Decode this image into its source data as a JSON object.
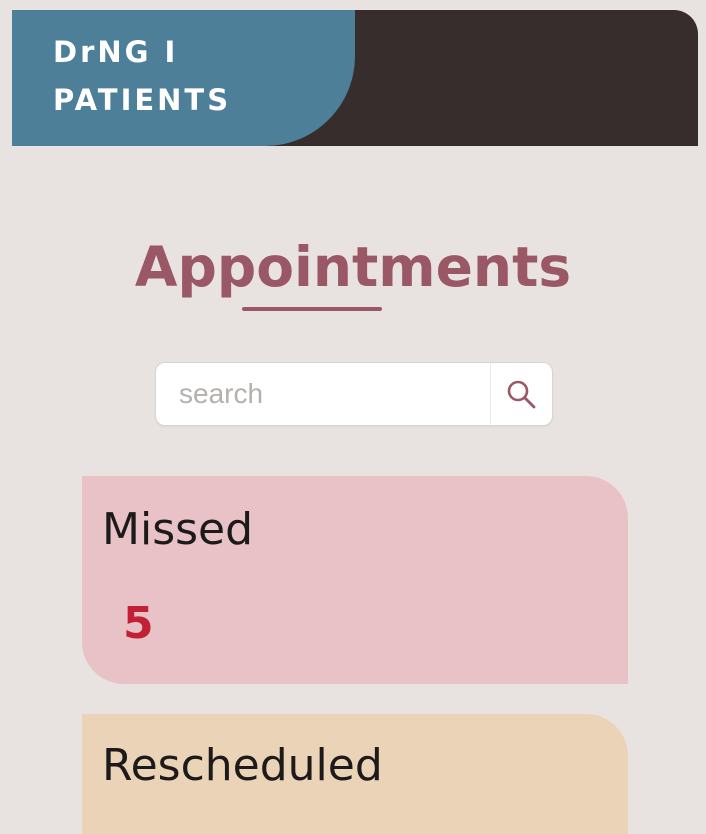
{
  "header": {
    "brand_line1": "DrNG I",
    "brand_line2": "PATIENTS"
  },
  "page": {
    "title": "Appointments"
  },
  "search": {
    "placeholder": "search",
    "value": ""
  },
  "cards": [
    {
      "label": "Missed",
      "count": "5",
      "color": "#e8c2c6"
    },
    {
      "label": "Rescheduled",
      "count": "",
      "color": "#ebd3b8"
    }
  ],
  "colors": {
    "brand": "#4e7f98",
    "header_dark": "#372d2c",
    "accent": "#9a5765",
    "count_red": "#c22035",
    "background": "#e8e3e0"
  },
  "icons": {
    "search": "search-icon"
  }
}
